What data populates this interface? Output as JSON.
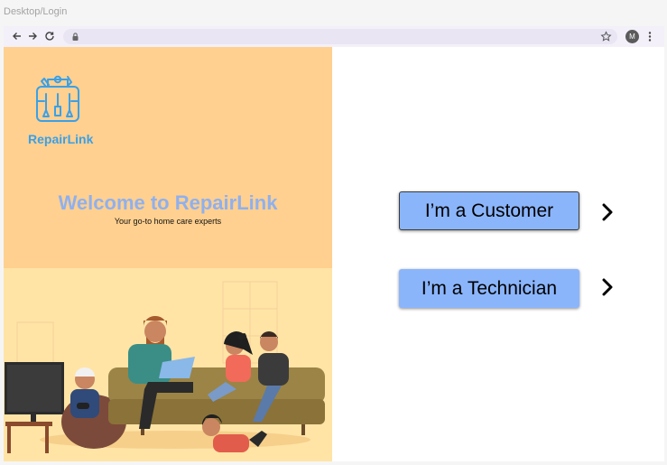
{
  "frame": {
    "label": "Desktop/Login"
  },
  "browser": {
    "avatar_initial": "M"
  },
  "brand": {
    "name": "RepairLink",
    "welcome": "Welcome to RepairLink",
    "tagline": "Your go-to home care experts",
    "accent_color": "#3aa0e8",
    "panel_color": "#ffd08f"
  },
  "choices": {
    "customer_label": "I’m a Customer",
    "technician_label": "I’m a Technician",
    "button_color": "#8bb5fb"
  }
}
